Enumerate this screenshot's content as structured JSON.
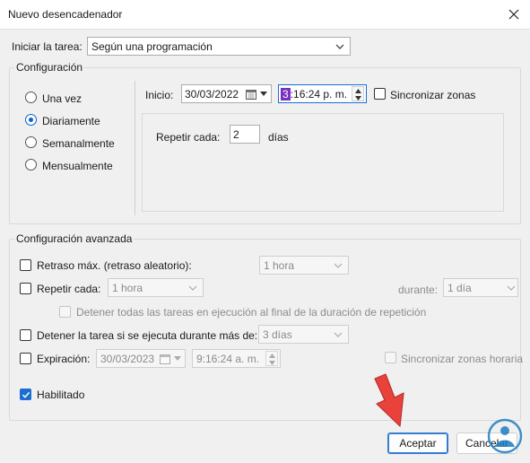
{
  "window": {
    "title": "Nuevo desencadenador"
  },
  "start_task": {
    "label": "Iniciar la tarea:",
    "value": "Según una programación"
  },
  "configuracion": {
    "legend": "Configuración",
    "schedule_options": [
      {
        "label": "Una vez",
        "checked": false
      },
      {
        "label": "Diariamente",
        "checked": true
      },
      {
        "label": "Semanalmente",
        "checked": false
      },
      {
        "label": "Mensualmente",
        "checked": false
      }
    ],
    "start_label": "Inicio:",
    "start_date": "30/03/2022",
    "start_time_cursor": "3",
    "start_time_rest": ":16:24 p. m.",
    "sync_zones_label": "Sincronizar zonas",
    "repeat_every_label": "Repetir cada:",
    "repeat_every_value": "2",
    "repeat_every_unit": "días"
  },
  "avanzada": {
    "legend": "Configuración avanzada",
    "delay_label": "Retraso máx. (retraso aleatorio):",
    "delay_value": "1 hora",
    "repeat_label": "Repetir cada:",
    "repeat_value": "1 hora",
    "duration_label": "durante:",
    "duration_value": "1 día",
    "stop_all_label": "Detener todas las tareas en ejecución al final de la duración de repetición",
    "stop_if_label": "Detener la tarea si se ejecuta durante más de:",
    "stop_if_value": "3 días",
    "expiration_label": "Expiración:",
    "expiration_date": "30/03/2023",
    "expiration_time": "9:16:24 a. m.",
    "sync_zones_label": "Sincronizar zonas horaria",
    "enabled_label": "Habilitado",
    "enabled_checked": true
  },
  "buttons": {
    "ok": "Aceptar",
    "cancel": "Cancelar"
  },
  "colors": {
    "accent": "#0a64c8",
    "arrow": "#e8423a",
    "watermark": "#1f7bc1"
  },
  "icons": [
    "close-icon",
    "chevron-down-icon",
    "calendar-icon",
    "spin-up-icon",
    "spin-down-icon",
    "check-icon",
    "arrow-annotation-icon",
    "watermark-logo-icon"
  ]
}
